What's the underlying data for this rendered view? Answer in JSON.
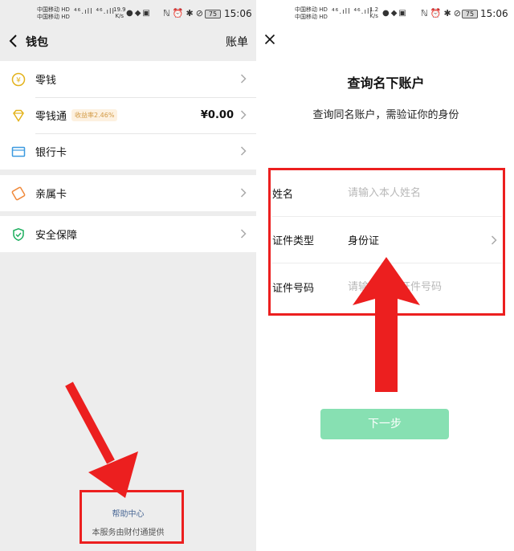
{
  "left": {
    "status": {
      "carrier1": "中国移动 HD",
      "carrier2": "中国移动 HD",
      "signal": "⁴⁶.ıll ⁴⁶.ıll",
      "speed_value": "19.9",
      "speed_unit": "K/s",
      "battery": "75",
      "time": "15:06"
    },
    "nav": {
      "title": "钱包",
      "right": "账单"
    },
    "items": [
      {
        "label": "零钱",
        "tag": "",
        "amount": ""
      },
      {
        "label": "零钱通",
        "tag": "收益率2.46%",
        "amount": "¥0.00"
      },
      {
        "label": "银行卡",
        "tag": "",
        "amount": ""
      },
      {
        "label": "亲属卡",
        "tag": "",
        "amount": ""
      },
      {
        "label": "安全保障",
        "tag": "",
        "amount": ""
      }
    ],
    "footer": {
      "help": "帮助中心",
      "note": "本服务由财付通提供"
    }
  },
  "right": {
    "status": {
      "carrier1": "中国移动 HD",
      "carrier2": "中国移动 HD",
      "signal": "⁴⁶.ıll ⁴⁶.ıll",
      "speed_value": "1.2",
      "speed_unit": "K/s",
      "battery": "75",
      "time": "15:06"
    },
    "title": "查询名下账户",
    "subtitle": "查询同名账户，需验证你的身份",
    "form": {
      "name_label": "姓名",
      "name_placeholder": "请输入本人姓名",
      "idtype_label": "证件类型",
      "idtype_value": "身份证",
      "idnum_label": "证件号码",
      "idnum_placeholder": "请输入本人证件号码"
    },
    "next_button": "下一步"
  },
  "colors": {
    "accent_green": "#87e0b2",
    "annotation_red": "#ec1f1f",
    "link_blue": "#4a6895",
    "tag_orange": "#d29a45"
  },
  "icons": [
    "back-icon",
    "coin-icon",
    "diamond-icon",
    "card-icon",
    "family-card-icon",
    "shield-icon",
    "chevron-right-icon",
    "close-icon"
  ]
}
